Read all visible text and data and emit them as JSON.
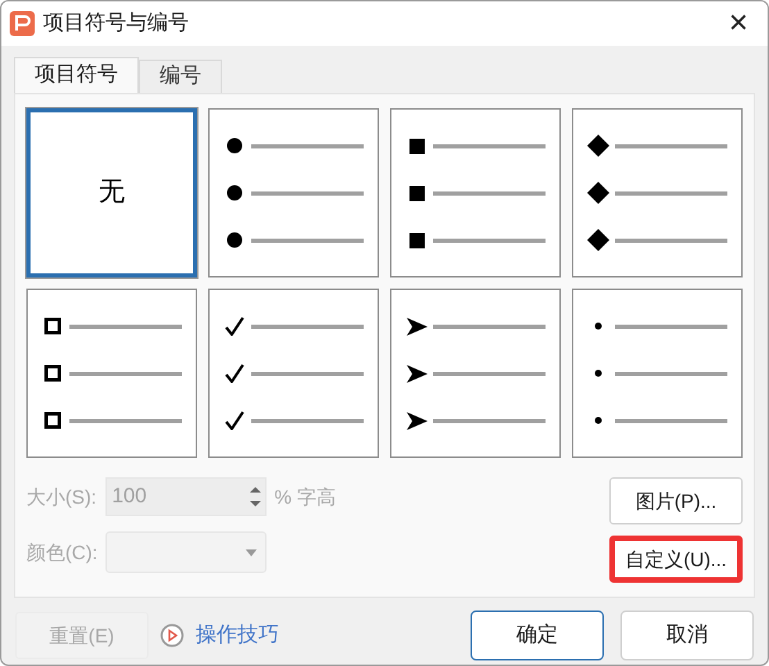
{
  "window": {
    "title": "项目符号与编号",
    "close": "×"
  },
  "tabs": [
    {
      "label": "项目符号",
      "selected": true
    },
    {
      "label": "编号",
      "selected": false
    }
  ],
  "bullets": [
    {
      "kind": "none",
      "text": "无",
      "selected": true
    },
    {
      "kind": "dot",
      "selected": false
    },
    {
      "kind": "square",
      "selected": false
    },
    {
      "kind": "diamond",
      "selected": false
    },
    {
      "kind": "hollow-square",
      "selected": false
    },
    {
      "kind": "check",
      "selected": false
    },
    {
      "kind": "arrowhead",
      "selected": false
    },
    {
      "kind": "small-dot",
      "selected": false
    }
  ],
  "size": {
    "label": "大小(S):",
    "value": "100",
    "unit": "% 字高",
    "disabled": true
  },
  "color": {
    "label": "颜色(C):",
    "disabled": true
  },
  "side_buttons": [
    {
      "label": "图片(P)...",
      "highlighted": false
    },
    {
      "label": "自定义(U)...",
      "highlighted": true
    }
  ],
  "footer": {
    "reset": {
      "label": "重置(E)",
      "disabled": true
    },
    "tips": "操作技巧",
    "ok": "确定",
    "cancel": "取消"
  }
}
